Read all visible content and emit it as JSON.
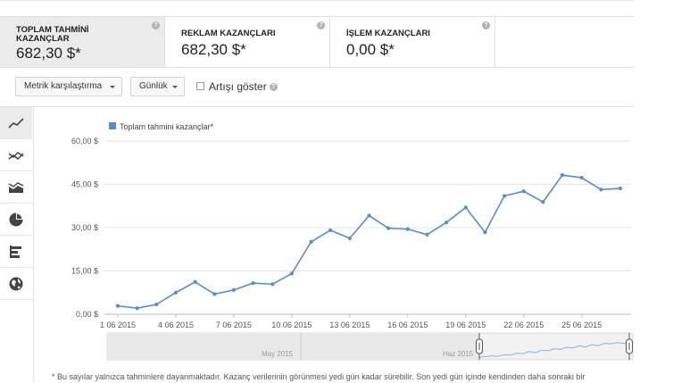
{
  "cards": [
    {
      "label_line1": "TOPLAM TAHMİNİ",
      "label_line2": "KAZANÇLAR",
      "value": "682,30 $*",
      "help": "?"
    },
    {
      "label_line1": "REKLAM KAZANÇLARI",
      "label_line2": "",
      "value": "682,30 $*",
      "help": "?"
    },
    {
      "label_line1": "İŞLEM KAZANÇLARI",
      "label_line2": "",
      "value": "0,00 $*",
      "help": "?"
    }
  ],
  "toolbar": {
    "compare_label": "Metrik karşılaştırma",
    "period_label": "Günlük",
    "show_growth_label": "Artışı göster",
    "help": "?"
  },
  "sidebar_icons": [
    "line-chart-icon",
    "multi-line-chart-icon",
    "area-chart-icon",
    "pie-chart-icon",
    "bar-chart-icon",
    "globe-icon"
  ],
  "chart_data": {
    "type": "line",
    "legend": "Toplam tahmini kazançlar*",
    "legend_position": "top-left",
    "series_color": "#5b8bc9",
    "grid": true,
    "ylim": [
      0,
      60
    ],
    "y_ticks": [
      "0,00 $",
      "15,00 $",
      "30,00 $",
      "45,00 $",
      "60,00 $"
    ],
    "x_tick_labels": [
      "1 06 2015",
      "4 06 2015",
      "7 06 2015",
      "10 06 2015",
      "13 06 2015",
      "16 06 2015",
      "19 06 2015",
      "22 06 2015",
      "25 06 2015"
    ],
    "x": [
      "2015-06-01",
      "2015-06-02",
      "2015-06-03",
      "2015-06-04",
      "2015-06-05",
      "2015-06-06",
      "2015-06-07",
      "2015-06-08",
      "2015-06-09",
      "2015-06-10",
      "2015-06-11",
      "2015-06-12",
      "2015-06-13",
      "2015-06-14",
      "2015-06-15",
      "2015-06-16",
      "2015-06-17",
      "2015-06-18",
      "2015-06-19",
      "2015-06-20",
      "2015-06-21",
      "2015-06-22",
      "2015-06-23",
      "2015-06-24",
      "2015-06-25",
      "2015-06-26",
      "2015-06-27"
    ],
    "values": [
      2.9,
      2.1,
      3.4,
      7.5,
      11.2,
      7.0,
      8.4,
      10.8,
      10.4,
      14.1,
      25.1,
      29.1,
      26.3,
      34.2,
      29.8,
      29.5,
      27.6,
      31.8,
      37.0,
      28.4,
      41.0,
      42.6,
      38.9,
      48.2,
      47.3,
      43.2,
      43.6
    ]
  },
  "navigator": {
    "month_labels": [
      "May 2015",
      "Haz 2015"
    ],
    "overview_values": [
      0.8,
      1.5,
      2.4,
      1.9,
      3.6,
      3.2,
      5.4,
      4.9,
      7.2,
      6.0,
      8.8,
      8.1,
      10.4,
      9.6,
      12.0,
      11.2,
      13.6,
      12.4,
      15.0,
      13.8,
      16.4,
      15.9,
      17.2,
      16.5,
      16.9
    ]
  },
  "footnote": "* Bu sayılar yalnızca tahminlere dayanmaktadır. Kazanç verilerinin görünmesi yedi gün kadar sürebilir. Son yedi gün içinde kendinden daha sonraki bir"
}
